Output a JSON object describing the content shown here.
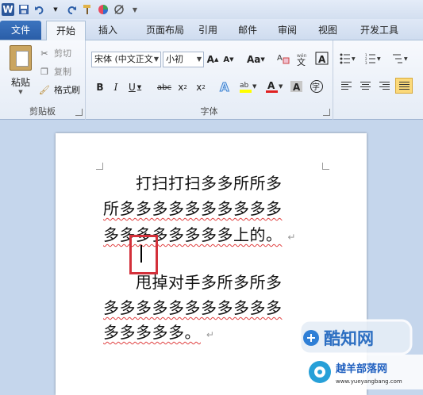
{
  "quick_access": {
    "logo": "W",
    "icons": [
      "save-icon",
      "undo-icon",
      "redo-icon",
      "format-painter-icon",
      "color-wheel-icon",
      "strikethrough-icon",
      "customize-icon"
    ]
  },
  "tabs": [
    "文件",
    "开始",
    "插入",
    "页面布局",
    "引用",
    "邮件",
    "审阅",
    "视图",
    "开发工具"
  ],
  "clipboard": {
    "paste": "粘贴",
    "cut": "剪切",
    "copy": "复制",
    "format_painter": "格式刷",
    "group": "剪贴板"
  },
  "font": {
    "name": "宋体 (中文正文",
    "size": "小初",
    "group": "字体"
  },
  "document": {
    "lines": [
      "　　打扫打扫多多所所多",
      "所多多多多多多多多多多",
      "多多多多多多多多上的。",
      "",
      "　　甩掉对手多所多所多",
      "多多多多多多多多多多多",
      "多多多多多。"
    ]
  },
  "watermarks": {
    "primary": "酷知网",
    "secondary": "越羊部落网",
    "url": "www.yueyangbang.com"
  },
  "colors": {
    "file_tab": "#2b579a",
    "highlight_box": "#d3303a",
    "spell_error": "#e04040"
  }
}
